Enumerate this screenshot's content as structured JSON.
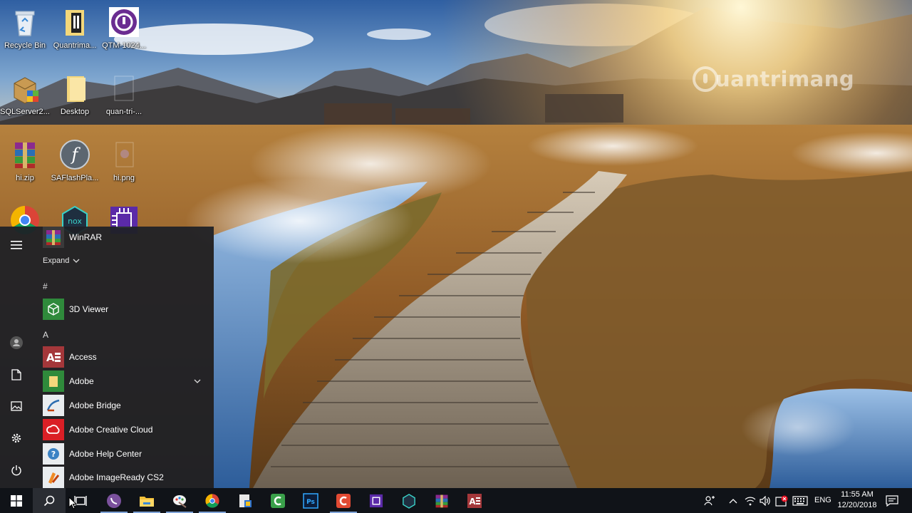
{
  "desktop": {
    "icons": [
      {
        "label": "Recycle Bin",
        "icon": "recycle-bin-icon"
      },
      {
        "label": "Quantrima...",
        "icon": "folder-icon"
      },
      {
        "label": "QTM-1024...",
        "icon": "qtm-logo-icon"
      },
      {
        "label": "SQLServer2...",
        "icon": "installer-box-icon"
      },
      {
        "label": "Desktop",
        "icon": "folder-icon"
      },
      {
        "label": "quan-tri-...",
        "icon": "image-file-icon"
      },
      {
        "label": "hi.zip",
        "icon": "winrar-archive-icon"
      },
      {
        "label": "SAFlashPla...",
        "icon": "flash-player-icon"
      },
      {
        "label": "hi.png",
        "icon": "image-file-icon"
      },
      {
        "label": "",
        "icon": "chrome-icon"
      },
      {
        "label": "",
        "icon": "nox-icon"
      },
      {
        "label": "",
        "icon": "chip-icon"
      }
    ],
    "watermark": "uantrimang"
  },
  "start_menu": {
    "rail": {
      "menu_icon": "hamburger-icon",
      "user_icon": "user-icon",
      "documents_icon": "document-icon",
      "pictures_icon": "pictures-icon",
      "settings_icon": "gear-icon",
      "power_icon": "power-icon"
    },
    "top_app": "WinRAR",
    "expand_label": "Expand",
    "groups": [
      {
        "letter": "#",
        "apps": [
          "3D Viewer"
        ]
      },
      {
        "letter": "A",
        "apps": [
          "Access",
          "Adobe",
          "Adobe Bridge",
          "Adobe Creative Cloud",
          "Adobe Help Center",
          "Adobe ImageReady CS2"
        ]
      }
    ]
  },
  "taskbar": {
    "buttons": [
      {
        "name": "start-button",
        "icon": "windows-logo-icon"
      },
      {
        "name": "search-button",
        "icon": "search-icon"
      },
      {
        "name": "task-view-button",
        "icon": "task-view-icon"
      },
      {
        "name": "viber-button",
        "icon": "viber-icon"
      },
      {
        "name": "file-explorer-button",
        "icon": "folder-icon"
      },
      {
        "name": "paint-button",
        "icon": "paint-icon"
      },
      {
        "name": "chrome-button",
        "icon": "chrome-icon"
      },
      {
        "name": "installer-button",
        "icon": "installer-icon"
      },
      {
        "name": "camtasia-button",
        "icon": "camtasia-icon"
      },
      {
        "name": "photoshop-button",
        "icon": "photoshop-icon"
      },
      {
        "name": "camtasia-recorder-button",
        "icon": "recorder-icon"
      },
      {
        "name": "chip-app-button",
        "icon": "chip-icon"
      },
      {
        "name": "nox-button",
        "icon": "nox-icon"
      },
      {
        "name": "winrar-button",
        "icon": "winrar-icon"
      },
      {
        "name": "access-button",
        "icon": "access-icon"
      }
    ],
    "tray": {
      "language": "ENG",
      "time": "11:55 AM",
      "date": "12/20/2018"
    }
  },
  "colors": {
    "taskbar": "#101318",
    "start_menu": "#1f2126",
    "access_red": "#a4373a",
    "accent_green": "#2f8a3b"
  }
}
